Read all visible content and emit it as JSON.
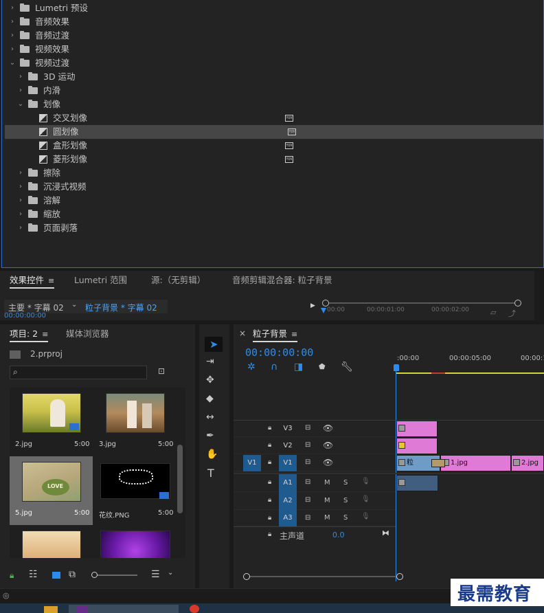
{
  "effects_tree": {
    "items": [
      {
        "label": "Lumetri 预设",
        "level": 0,
        "expanded": false,
        "kind": "folder",
        "star": true
      },
      {
        "label": "音频效果",
        "level": 0,
        "expanded": false,
        "kind": "folder"
      },
      {
        "label": "音频过渡",
        "level": 0,
        "expanded": false,
        "kind": "folder"
      },
      {
        "label": "视频效果",
        "level": 0,
        "expanded": false,
        "kind": "folder"
      },
      {
        "label": "视频过渡",
        "level": 0,
        "expanded": true,
        "kind": "folder"
      },
      {
        "label": "3D 运动",
        "level": 1,
        "expanded": false,
        "kind": "folder"
      },
      {
        "label": "内滑",
        "level": 1,
        "expanded": false,
        "kind": "folder"
      },
      {
        "label": "划像",
        "level": 1,
        "expanded": true,
        "kind": "folder"
      },
      {
        "label": "交叉划像",
        "level": 2,
        "kind": "effect",
        "badge": "YUV"
      },
      {
        "label": "圆划像",
        "level": 2,
        "kind": "effect",
        "badge": "YUV",
        "selected": true
      },
      {
        "label": "盒形划像",
        "level": 2,
        "kind": "effect",
        "badge": "YUV"
      },
      {
        "label": "菱形划像",
        "level": 2,
        "kind": "effect",
        "badge": "YUV"
      },
      {
        "label": "擦除",
        "level": 1,
        "expanded": false,
        "kind": "folder"
      },
      {
        "label": "沉浸式视频",
        "level": 1,
        "expanded": false,
        "kind": "folder"
      },
      {
        "label": "溶解",
        "level": 1,
        "expanded": false,
        "kind": "folder"
      },
      {
        "label": "缩放",
        "level": 1,
        "expanded": false,
        "kind": "folder"
      },
      {
        "label": "页面剥落",
        "level": 1,
        "expanded": false,
        "kind": "folder"
      }
    ]
  },
  "source_panel": {
    "tabs": [
      "效果控件",
      "Lumetri 范围",
      "源:（无剪辑）",
      "音频剪辑混合器: 粒子背景"
    ],
    "menu_glyph": "≡",
    "master_clip": "主要 * 字幕 02",
    "sequence_clip": "粒子背景 * 字幕 02",
    "timecode": "00:00:00:00",
    "ruler_labels": [
      "00:00",
      "00:00:01:00",
      "00:00:02:00"
    ]
  },
  "project_panel": {
    "tabs": [
      "项目: 2",
      "媒体浏览器"
    ],
    "project_file": "2.prproj",
    "search_placeholder": "",
    "items": [
      {
        "name": "2.jpg",
        "duration": "5:00",
        "badge": true
      },
      {
        "name": "3.jpg",
        "duration": "5:00",
        "badge": false
      },
      {
        "name": "5.jpg",
        "duration": "5:00",
        "badge": false,
        "selected": true
      },
      {
        "name": "花纹.PNG",
        "duration": "5:00",
        "badge": true
      },
      {
        "name": "",
        "duration": "",
        "badge": false
      },
      {
        "name": "",
        "duration": "",
        "badge": false
      }
    ],
    "thumb_text_love": "LOVE"
  },
  "timeline": {
    "sequence_name": "粒子背景",
    "close_glyph": "×",
    "menu_glyph": "≡",
    "timecode": "00:00:00:00",
    "ruler_labels": [
      ":00:00",
      "00:00:05:00",
      "00:00:1"
    ],
    "video_tracks": [
      {
        "name": "V3",
        "clip_label": "",
        "target": false
      },
      {
        "name": "V2",
        "clip_label": "",
        "target": false
      },
      {
        "name": "V1",
        "clip_label": "粒",
        "target": true,
        "source": "V1"
      }
    ],
    "v1_clips": [
      "1.jpg",
      "2.jpg"
    ],
    "audio_tracks": [
      {
        "name": "A1",
        "m": "M",
        "s": "S"
      },
      {
        "name": "A2",
        "m": "M",
        "s": "S"
      },
      {
        "name": "A3",
        "m": "M",
        "s": "S"
      }
    ],
    "master_label": "主声道",
    "master_value": "0.0"
  },
  "watermark": "最需教育",
  "colors": {
    "accent_blue": "#2d8ceb",
    "clip_pink": "#e07ad7",
    "clip_blue": "#6f9bc7",
    "track_target": "#1f5b8f",
    "panel_bg": "#232323"
  }
}
